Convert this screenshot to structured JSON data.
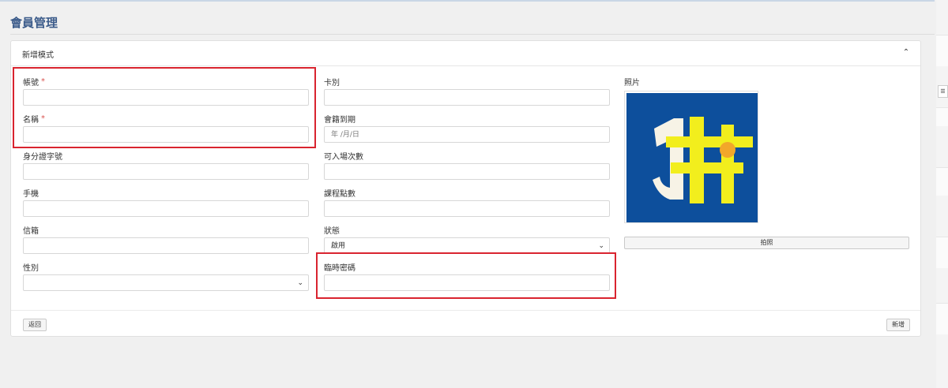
{
  "page": {
    "title": "會員管理"
  },
  "card": {
    "title": "新增模式",
    "collapse_icon": "chevrons-up-icon"
  },
  "form": {
    "account": {
      "label": "帳號",
      "required_mark": "*",
      "value": ""
    },
    "name": {
      "label": "名稱",
      "required_mark": "*",
      "value": ""
    },
    "id_number": {
      "label": "身分證字號",
      "value": ""
    },
    "phone": {
      "label": "手機",
      "value": ""
    },
    "email": {
      "label": "信箱",
      "value": ""
    },
    "gender": {
      "label": "性別",
      "selected": ""
    },
    "card_type": {
      "label": "卡別",
      "value": ""
    },
    "membership_expiry": {
      "label": "會籍到期",
      "placeholder": "年 /月/日"
    },
    "entry_count": {
      "label": "可入場次數",
      "value": ""
    },
    "course_points": {
      "label": "課程點數",
      "value": ""
    },
    "status": {
      "label": "狀態",
      "selected": "啟用"
    },
    "temp_password": {
      "label": "臨時密碼",
      "value": ""
    },
    "photo": {
      "label": "照片",
      "capture_button": "拍照"
    }
  },
  "footer": {
    "back_button": "返回",
    "add_button": "新增"
  },
  "colors": {
    "logo_background": "#0d4f9c",
    "logo_yellow": "#f2ee1d",
    "logo_orange": "#f2a72a",
    "logo_cream": "#f7f3e6",
    "highlight": "#d9242f"
  }
}
